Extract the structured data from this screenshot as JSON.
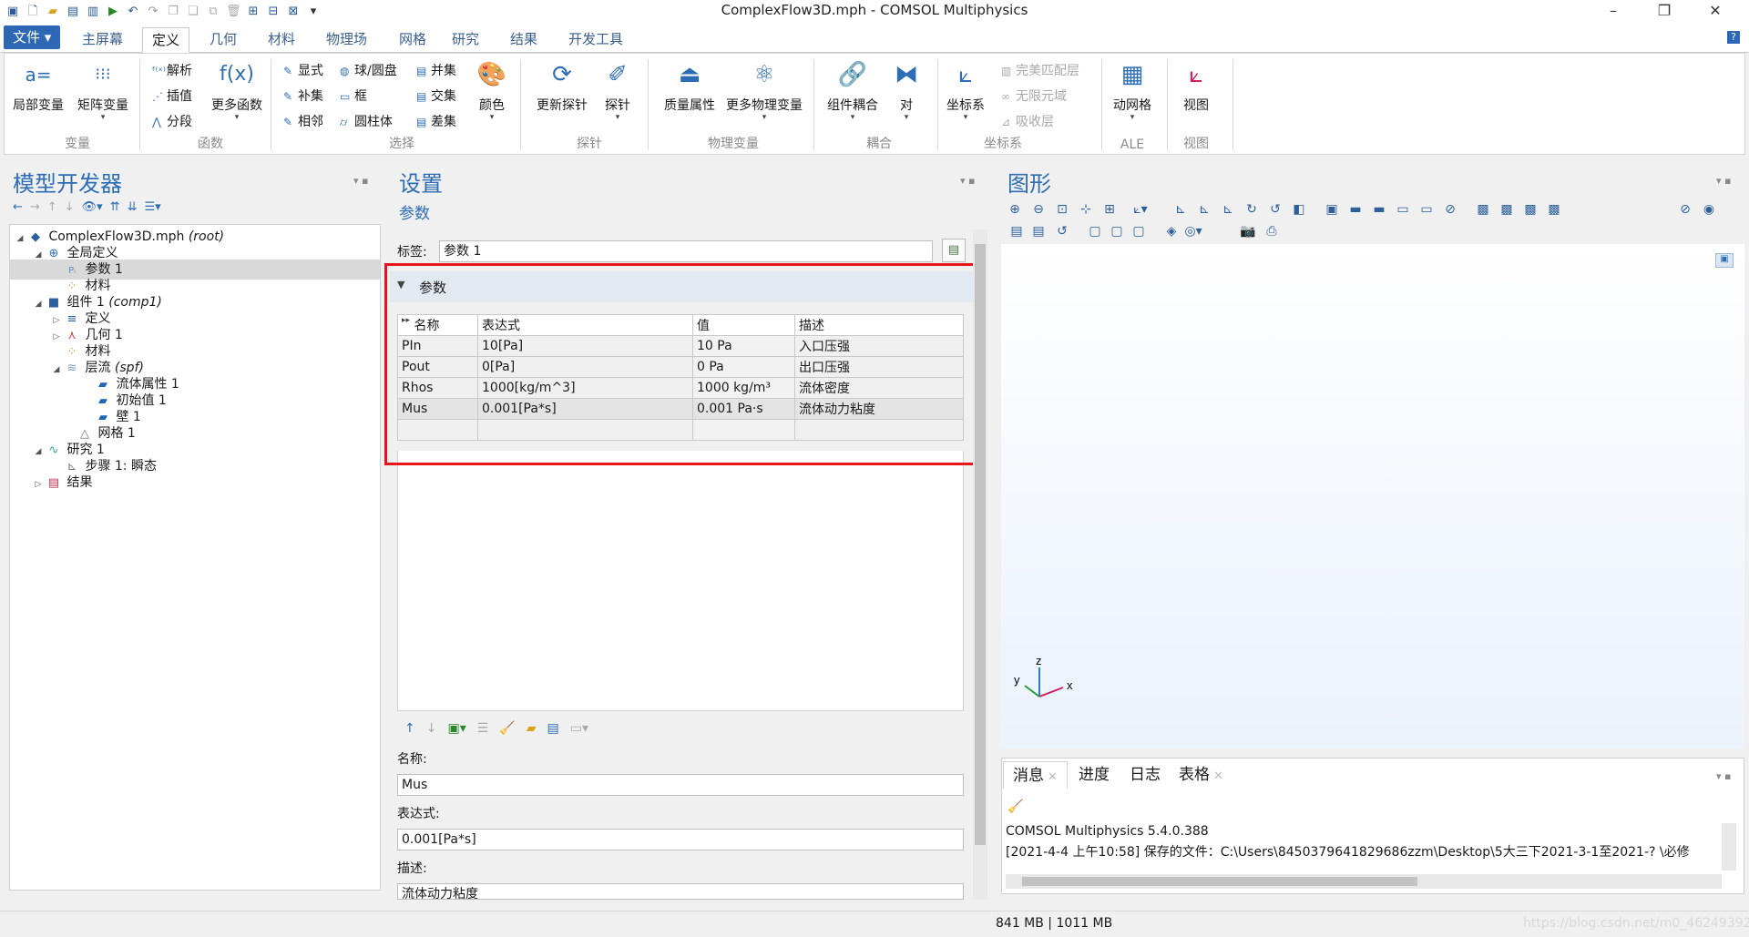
{
  "window": {
    "title": "ComplexFlow3D.mph - COMSOL Multiphysics",
    "minimize": "–",
    "restore": "❐",
    "close": "✕"
  },
  "ribbon_tabs": [
    "文件 ▾",
    "主屏幕",
    "定义",
    "几何",
    "材料",
    "物理场",
    "网格",
    "研究",
    "结果",
    "开发工具"
  ],
  "ribbon": {
    "groups": {
      "variables": "变量",
      "functions": "函数",
      "selections": "选择",
      "probes": "探针",
      "physics_vars": "物理变量",
      "coupling": "耦合",
      "coordinates": "坐标系",
      "ale": "ALE",
      "view": "视图"
    },
    "local_var": "局部变量",
    "matrix_var": "矩阵变量",
    "analytic": "解析",
    "interp": "插值",
    "piecewise": "分段",
    "more_funcs": "更多函数",
    "explicit": "显式",
    "complement": "补集",
    "adjacent": "相邻",
    "ball": "球/圆盘",
    "box": "框",
    "cylinder": "圆柱体",
    "union": "并集",
    "intersection": "交集",
    "difference": "差集",
    "color": "颜色",
    "update_probes": "更新探针",
    "probes": "探针",
    "mass_props": "质量属性",
    "more_phys_vars": "更多物理变量",
    "comp_coupling": "组件耦合",
    "pair": "对",
    "coord_sys": "坐标系",
    "pml": "完美匹配层",
    "infinite": "无限元域",
    "absorbing": "吸收层",
    "moving_mesh": "动网格",
    "view_btn": "视图",
    "fx_glyph": "f(x)",
    "aeq_glyph": "a="
  },
  "model_builder": {
    "title": "模型开发器",
    "tree": [
      {
        "label": "ComplexFlow3D.mph",
        "tag": "(root)"
      },
      {
        "label": "全局定义",
        "tag": ""
      },
      {
        "label": "参数 1",
        "tag": ""
      },
      {
        "label": "材料",
        "tag": ""
      },
      {
        "label": "组件 1",
        "tag": "(comp1)"
      },
      {
        "label": "定义",
        "tag": ""
      },
      {
        "label": "几何 1",
        "tag": ""
      },
      {
        "label": "材料",
        "tag": ""
      },
      {
        "label": "层流",
        "tag": "(spf)"
      },
      {
        "label": "流体属性 1",
        "tag": ""
      },
      {
        "label": "初始值 1",
        "tag": ""
      },
      {
        "label": "壁 1",
        "tag": ""
      },
      {
        "label": "网格 1",
        "tag": ""
      },
      {
        "label": "研究 1",
        "tag": ""
      },
      {
        "label": "步骤 1: 瞬态",
        "tag": ""
      },
      {
        "label": "结果",
        "tag": ""
      }
    ]
  },
  "settings": {
    "title": "设置",
    "subtitle": "参数",
    "label_caption": "标签:",
    "label_value": "参数 1",
    "section": "参数",
    "columns": [
      "名称",
      "表达式",
      "值",
      "描述"
    ],
    "rows": [
      [
        "PIn",
        "10[Pa]",
        "10 Pa",
        "入口压强"
      ],
      [
        "Pout",
        "0[Pa]",
        "0 Pa",
        "出口压强"
      ],
      [
        "Rhos",
        "1000[kg/m^3]",
        "1000 kg/m³",
        "流体密度"
      ],
      [
        "Mus",
        "0.001[Pa*s]",
        "0.001 Pa·s",
        "流体动力粘度"
      ]
    ],
    "name_caption": "名称:",
    "name_value": "Mus",
    "expr_caption": "表达式:",
    "expr_value": "0.001[Pa*s]",
    "desc_caption": "描述:",
    "desc_value": "流体动力粘度"
  },
  "graphics": {
    "title": "图形",
    "axes": {
      "x": "x",
      "y": "y",
      "z": "z"
    }
  },
  "messages": {
    "tabs": [
      "消息",
      "进度",
      "日志",
      "表格"
    ],
    "lines": [
      "COMSOL Multiphysics 5.4.0.388",
      "[2021-4-4 上午10:58] 保存的文件：C:\\Users\\8450379641829686zzm\\Desktop\\5大三下2021-3-1至2021-? \\必修"
    ]
  },
  "status": {
    "memory": "841 MB | 1011 MB",
    "watermark": "https://blog.csdn.net/m0_46249392"
  },
  "colors": {
    "accent": "#2d6db5",
    "highlight": "#e8141b"
  }
}
